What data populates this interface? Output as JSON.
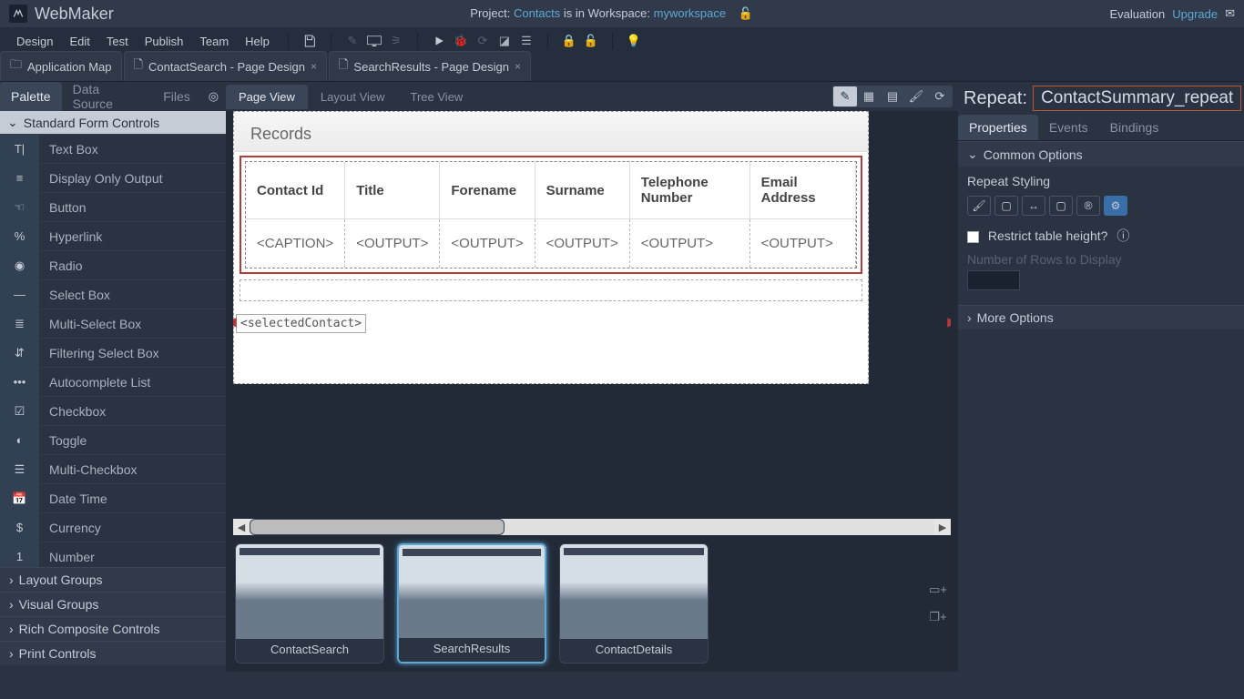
{
  "app": {
    "name": "WebMaker"
  },
  "project": {
    "prefix": "Project: ",
    "name": "Contacts",
    "mid": " is in Workspace: ",
    "workspace": "myworkspace"
  },
  "topright": {
    "eval": "Evaluation",
    "upgrade": "Upgrade"
  },
  "menus": [
    "Design",
    "Edit",
    "Test",
    "Publish",
    "Team",
    "Help"
  ],
  "tabs": [
    {
      "label": "Application Map",
      "closable": false
    },
    {
      "label": "ContactSearch - Page Design",
      "closable": true
    },
    {
      "label": "SearchResults - Page Design",
      "closable": true,
      "active": true
    }
  ],
  "leftTabs": {
    "palette": "Palette",
    "datasource": "Data Source",
    "files": "Files"
  },
  "paletteHeader": "Standard Form Controls",
  "controls": [
    "Text Box",
    "Display Only Output",
    "Button",
    "Hyperlink",
    "Radio",
    "Select Box",
    "Multi-Select Box",
    "Filtering Select Box",
    "Autocomplete List",
    "Checkbox",
    "Toggle",
    "Multi-Checkbox",
    "Date Time",
    "Currency",
    "Number"
  ],
  "categories": [
    "Layout Groups",
    "Visual Groups",
    "Rich Composite Controls",
    "Print Controls"
  ],
  "viewTabs": [
    "Page View",
    "Layout View",
    "Tree View"
  ],
  "records": {
    "title": "Records",
    "headers": [
      "Contact Id",
      "Title",
      "Forename",
      "Surname",
      "Telephone Number",
      "Email Address"
    ],
    "cells": [
      "<CAPTION>",
      "<OUTPUT>",
      "<OUTPUT>",
      "<OUTPUT>",
      "<OUTPUT>",
      "<OUTPUT>"
    ],
    "selected": "<selectedContact>"
  },
  "thumbs": [
    "ContactSearch",
    "SearchResults",
    "ContactDetails"
  ],
  "selection": {
    "label": "Repeat:",
    "name": "ContactSummary_repeat"
  },
  "propTabs": [
    "Properties",
    "Events",
    "Bindings"
  ],
  "propSections": {
    "common": "Common Options",
    "styling": "Repeat Styling",
    "restrict": "Restrict table height?",
    "numrows": "Number of Rows to Display",
    "more": "More Options"
  }
}
